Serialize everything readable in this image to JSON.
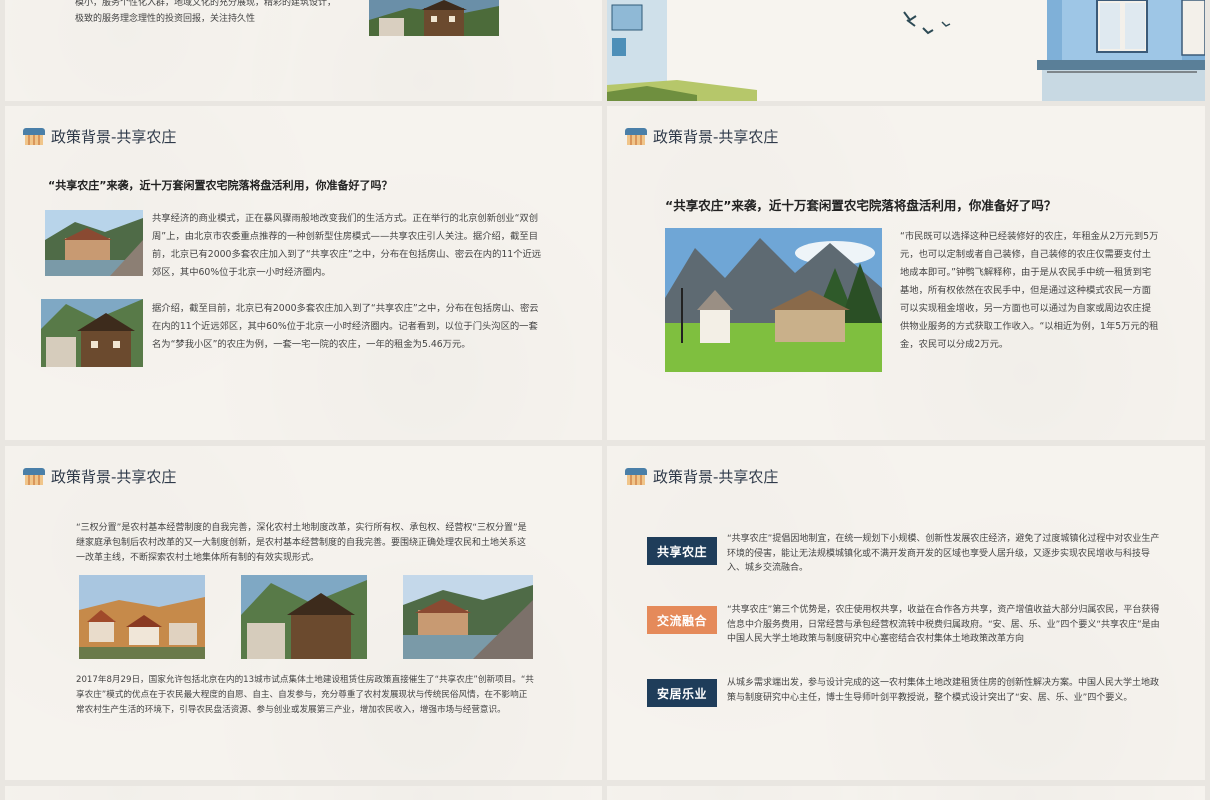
{
  "top_left": {
    "text_line1": "模小，服务个性化入群，地域文化的充分展现，精彩的建筑设计，",
    "text_line2": "极致的服务理念理性的投资回报，关注持久性"
  },
  "section_title": "政策背景-共享农庄",
  "slide_a": {
    "subtitle": "“共享农庄”来袭，近十万套闲置农宅院落将盘活利用，你准备好了吗？",
    "para1": "共享经济的商业模式，正在暴风骤雨般地改变我们的生活方式。正在举行的北京创新创业“双创周”上，由北京市农委重点推荐的一种创新型住房模式——共享农庄引人关注。据介绍，截至目前，北京已有2000多套农庄加入到了“共享农庄”之中，分布在包括房山、密云在内的11个近远郊区，其中60%位于北京一小时经济圈内。",
    "para2": "据介绍，截至目前，北京已有2000多套农庄加入到了“共享农庄”之中，分布在包括房山、密云在内的11个近远郊区，其中60%位于北京一小时经济圈内。记者看到，以位于门头沟区的一套名为“梦我小区”的农庄为例，一套一宅一院的农庄，一年的租金为5.46万元。"
  },
  "slide_b": {
    "subtitle": "“共享农庄”来袭，近十万套闲置农宅院落将盘活利用，你准备好了吗？",
    "para": "“市民既可以选择这种已经装修好的农庄，年租金从2万元到5万元，也可以定制或者自己装修，自己装修的农庄仅需要支付土地成本即可。”钟鹗飞解释称，由于是从农民手中统一租赁到宅基地，所有权依然在农民手中，但是通过这种模式农民一方面可以实现租金增收，另一方面也可以通过为自家或周边农庄提供物业服务的方式获取工作收入。“以相近为例，1年5万元的租金，农民可以分成2万元。"
  },
  "slide_c": {
    "para1": "“三权分置”是农村基本经营制度的自我完善，深化农村土地制度改革，实行所有权、承包权、经营权“三权分置”是继家庭承包制后农村改革的又一大制度创新，是农村基本经营制度的自我完善。要围绕正确处理农民和土地关系这一改革主线，不断探索农村土地集体所有制的有效实现形式。",
    "para2": "2017年8月29日，国家允许包括北京在内的13城市试点集体土地建设租赁住房政策直接催生了“共享农庄”创新项目。“共享农庄”模式的优点在于农民最大程度的自愿、自主、自发参与，充分尊重了农村发展现状与传统民俗风情，在不影响正常农村生产生活的环境下，引导农民盘活资源、参与创业或发展第三产业，增加农民收入，增强市场与经营意识。"
  },
  "slide_d": {
    "items": [
      {
        "tag": "共享农庄",
        "color": "#1f3d5a",
        "text": "“共享农庄”提倡因地制宜，在统一规划下小规模、创新性发展农庄经济，避免了过度城镇化过程中对农业生产环境的侵害，能让无法规模城镇化或不满开发商开发的区域也享受人居升级，又逐步实现农民增收与科技导入、城乡交流融合。"
      },
      {
        "tag": "交流融合",
        "color": "#e58a5a",
        "text": "“共享农庄”第三个优势是，农庄使用权共享，收益在合作各方共享，资产增值收益大部分归属农民，平台获得信息中介服务费用，日常经营与承包经营权流转中税费归属政府。“安、居、乐、业”四个要义“共享农庄”是由中国人民大学土地政策与制度研究中心塞密结合农村集体土地政策改革方向"
      },
      {
        "tag": "安居乐业",
        "color": "#1f3d5a",
        "text": "从城乡需求端出发，参与设计完成的这一农村集体土地改建租赁住房的创新性解决方案。中国人民大学土地政策与制度研究中心主任，博士生导师叶剑平教授说，整个模式设计突出了“安、居、乐、业”四个要义。"
      }
    ]
  }
}
